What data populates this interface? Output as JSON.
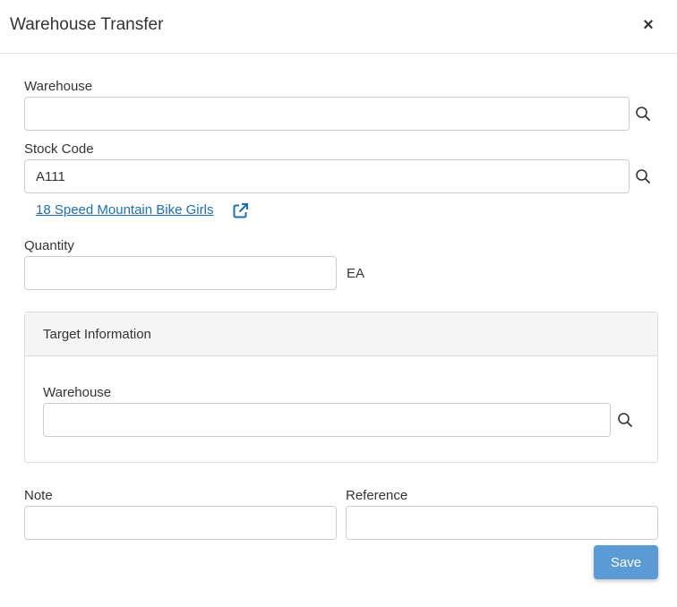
{
  "dialog": {
    "title": "Warehouse Transfer",
    "close_label": "×"
  },
  "form": {
    "warehouse_label": "Warehouse",
    "warehouse_value": "",
    "stock_code_label": "Stock Code",
    "stock_code_value": "A111",
    "stock_description_link": "18 Speed Mountain Bike Girls",
    "quantity_label": "Quantity",
    "quantity_value": "",
    "unit": "EA"
  },
  "target_panel": {
    "title": "Target Information",
    "warehouse_label": "Warehouse",
    "warehouse_value": ""
  },
  "footer": {
    "note_label": "Note",
    "note_value": "",
    "reference_label": "Reference",
    "reference_value": "",
    "save_label": "Save"
  },
  "colors": {
    "link": "#1a6fb5",
    "save_button": "#5b9bd5",
    "panel_header": "#f5f5f5",
    "border": "#cccccc"
  },
  "icons": {
    "search": "search-icon",
    "external_link": "external-link-icon",
    "close": "close-icon"
  }
}
